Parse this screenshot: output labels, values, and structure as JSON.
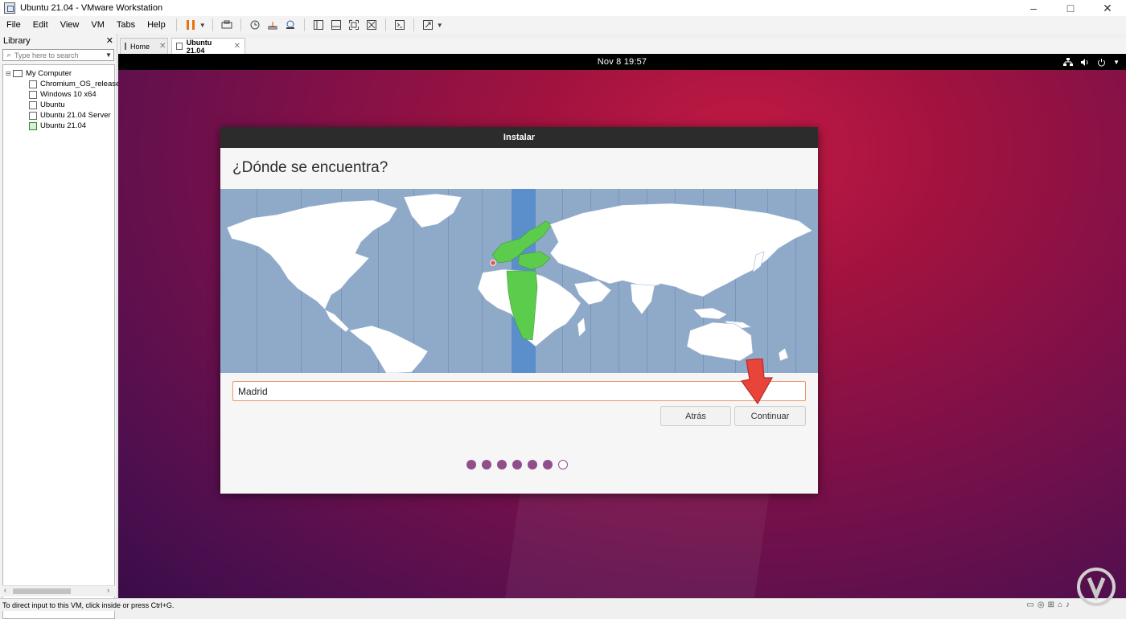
{
  "window": {
    "title": "Ubuntu 21.04 - VMware Workstation",
    "controls": [
      "–",
      "□",
      "✕"
    ]
  },
  "menu": [
    "File",
    "Edit",
    "View",
    "VM",
    "Tabs",
    "Help"
  ],
  "library": {
    "title": "Library",
    "close": "✕",
    "search_placeholder": "Type here to search",
    "root": "My Computer",
    "items": [
      "Chromium_OS_release-I",
      "Windows 10 x64",
      "Ubuntu",
      "Ubuntu 21.04 Server",
      "Ubuntu 21.04"
    ],
    "selected": "Ubuntu 21.04"
  },
  "tabs": [
    {
      "label": "Home",
      "active": false
    },
    {
      "label": "Ubuntu 21.04",
      "active": true
    }
  ],
  "guest": {
    "clock": "Nov 8  19:57",
    "dialog_title": "Instalar",
    "heading": "¿Dónde se encuentra?",
    "location_value": "Madrid",
    "back_button": "Atrás",
    "continue_button": "Continuar",
    "progress": {
      "total_steps": 7,
      "completed_steps": 6
    }
  },
  "status_text": "To direct input to this VM, click inside or press Ctrl+G.",
  "colors": {
    "accent_orange": "#e8720c",
    "map_ocean": "#8fa9c9",
    "timezone_band": "#5b8fcc",
    "highlight_zone": "#5ccc4c",
    "progress_dot": "#924d8b",
    "arrow_red": "#e8443a"
  }
}
